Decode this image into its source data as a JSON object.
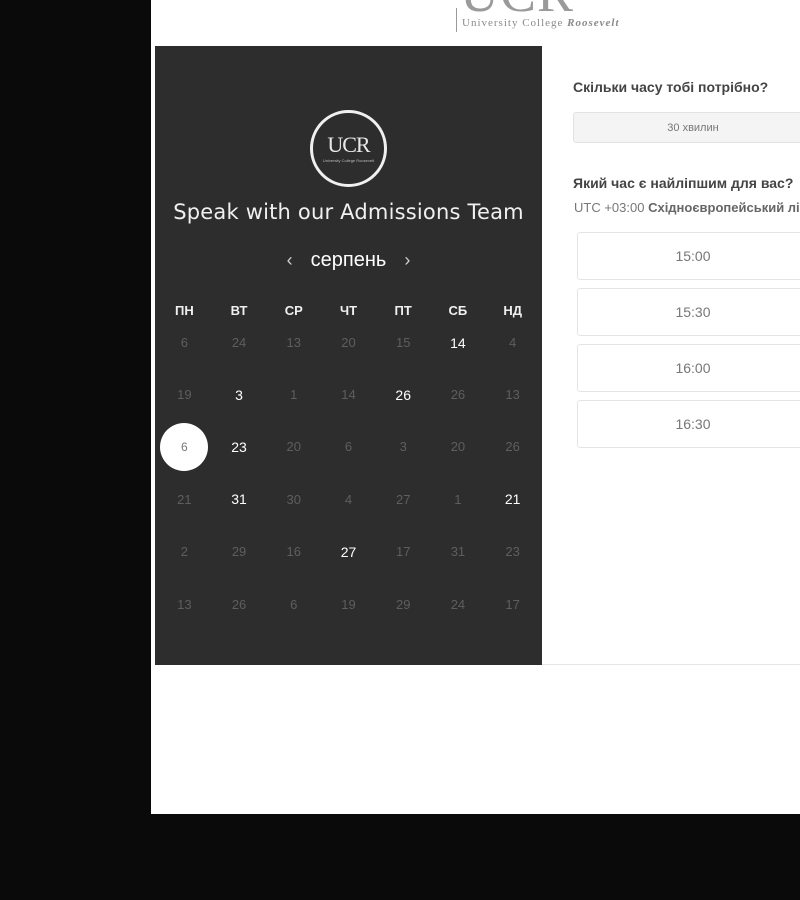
{
  "header": {
    "logo_letters": "UCR",
    "logo_subtitle_plain": "University College ",
    "logo_subtitle_italic": "Roosevelt"
  },
  "panel": {
    "logo_text": "UCR",
    "logo_subtext": "University College Roosevelt",
    "title": "Speak with our Admissions Team",
    "month": "серпень",
    "prev_icon": "‹",
    "next_icon": "›",
    "weekdays": [
      "ПН",
      "ВТ",
      "СР",
      "ЧТ",
      "ПТ",
      "СБ",
      "НД"
    ],
    "days": [
      {
        "label": "6",
        "state": "muted"
      },
      {
        "label": "24",
        "state": "muted"
      },
      {
        "label": "13",
        "state": "muted"
      },
      {
        "label": "20",
        "state": "muted"
      },
      {
        "label": "15",
        "state": "muted"
      },
      {
        "label": "14",
        "state": "available"
      },
      {
        "label": "4",
        "state": "muted"
      },
      {
        "label": "19",
        "state": "muted"
      },
      {
        "label": "3",
        "state": "available"
      },
      {
        "label": "1",
        "state": "muted"
      },
      {
        "label": "14",
        "state": "muted"
      },
      {
        "label": "26",
        "state": "available"
      },
      {
        "label": "26",
        "state": "muted"
      },
      {
        "label": "13",
        "state": "muted"
      },
      {
        "label": "6",
        "state": "selected"
      },
      {
        "label": "23",
        "state": "available"
      },
      {
        "label": "20",
        "state": "muted"
      },
      {
        "label": "6",
        "state": "muted"
      },
      {
        "label": "3",
        "state": "muted"
      },
      {
        "label": "20",
        "state": "muted"
      },
      {
        "label": "26",
        "state": "muted"
      },
      {
        "label": "21",
        "state": "muted"
      },
      {
        "label": "31",
        "state": "available"
      },
      {
        "label": "30",
        "state": "muted"
      },
      {
        "label": "4",
        "state": "muted"
      },
      {
        "label": "27",
        "state": "muted"
      },
      {
        "label": "1",
        "state": "muted"
      },
      {
        "label": "21",
        "state": "available"
      },
      {
        "label": "2",
        "state": "muted"
      },
      {
        "label": "29",
        "state": "muted"
      },
      {
        "label": "16",
        "state": "muted"
      },
      {
        "label": "27",
        "state": "available"
      },
      {
        "label": "17",
        "state": "muted"
      },
      {
        "label": "31",
        "state": "muted"
      },
      {
        "label": "23",
        "state": "muted"
      },
      {
        "label": "13",
        "state": "muted"
      },
      {
        "label": "26",
        "state": "muted"
      },
      {
        "label": "6",
        "state": "muted"
      },
      {
        "label": "19",
        "state": "muted"
      },
      {
        "label": "29",
        "state": "muted"
      },
      {
        "label": "24",
        "state": "muted"
      },
      {
        "label": "17",
        "state": "muted"
      }
    ]
  },
  "booking": {
    "duration_question": "Скільки часу тобі потрібно?",
    "duration_value": "30 хвилин",
    "time_question": "Який час є найліпшим для вас?",
    "timezone_prefix": "UTC +03:00 ",
    "timezone_name": "Східноєвропейський літній час",
    "slots": [
      "15:00",
      "15:30",
      "16:00",
      "16:30"
    ]
  },
  "colors": {
    "background": "#0a0a0a",
    "panel": "#2d2d2d",
    "available_day": "#ffffff",
    "muted_day": "#5e5e5e",
    "selected_circle": "#ffffff"
  }
}
